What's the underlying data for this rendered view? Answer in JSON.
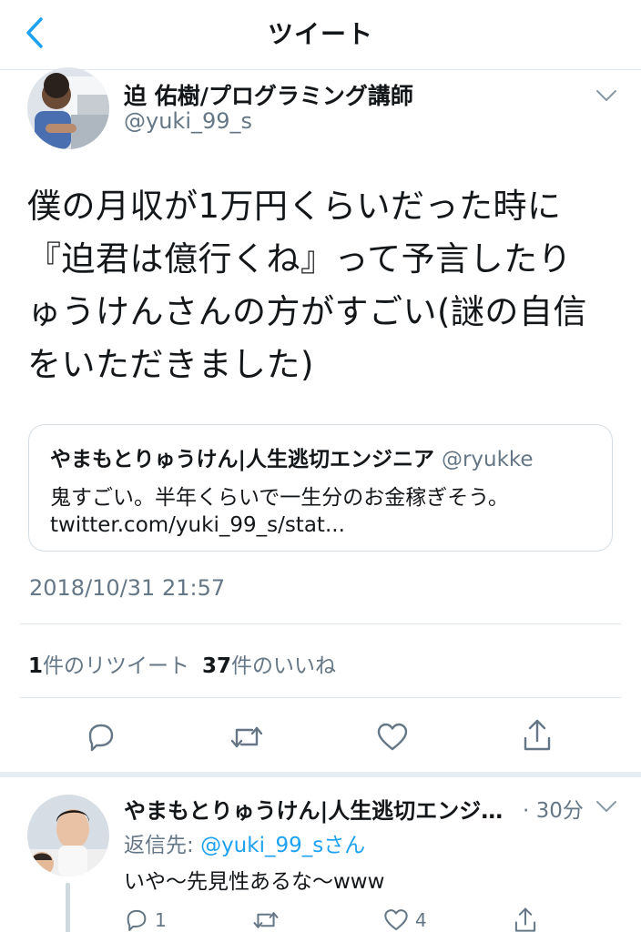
{
  "nav": {
    "title": "ツイート",
    "back_icon": "chevron-left-icon",
    "accent_color": "#1da1f2"
  },
  "tweet": {
    "author_name": "迫 佑樹/プログラミング講師",
    "author_handle": "@yuki_99_s",
    "text_lines": [
      "僕の月収が1万円くらいだった時に",
      "『迫君は億行くね』って予言したり",
      "ゅうけんさんの方がすごい(謎の自信",
      "をいただきました)"
    ],
    "quote": {
      "author_name": "やまもとりゅうけん|人生逃切エンジニア",
      "author_handle": "@ryukke",
      "text": "鬼すごい。半年くらいで一生分のお金稼ぎそう。",
      "link": "twitter.com/yuki_99_s/stat..."
    },
    "timestamp": "2018/10/31 21:57",
    "retweets_count": "1",
    "retweets_label": "件のリツイート",
    "likes_count": "37",
    "likes_label": "件のいいね",
    "actions": [
      "reply-icon",
      "retweet-icon",
      "like-icon",
      "share-icon"
    ]
  },
  "reply": {
    "author_name": "やまもとりゅうけん|人生逃切エンジ…",
    "time": "· 30分",
    "reply_to_label": "返信先: ",
    "reply_to_mention": "@yuki_99_sさん",
    "text": "いや〜先見性あるな〜www",
    "reply_count": "1",
    "like_count": "4"
  }
}
